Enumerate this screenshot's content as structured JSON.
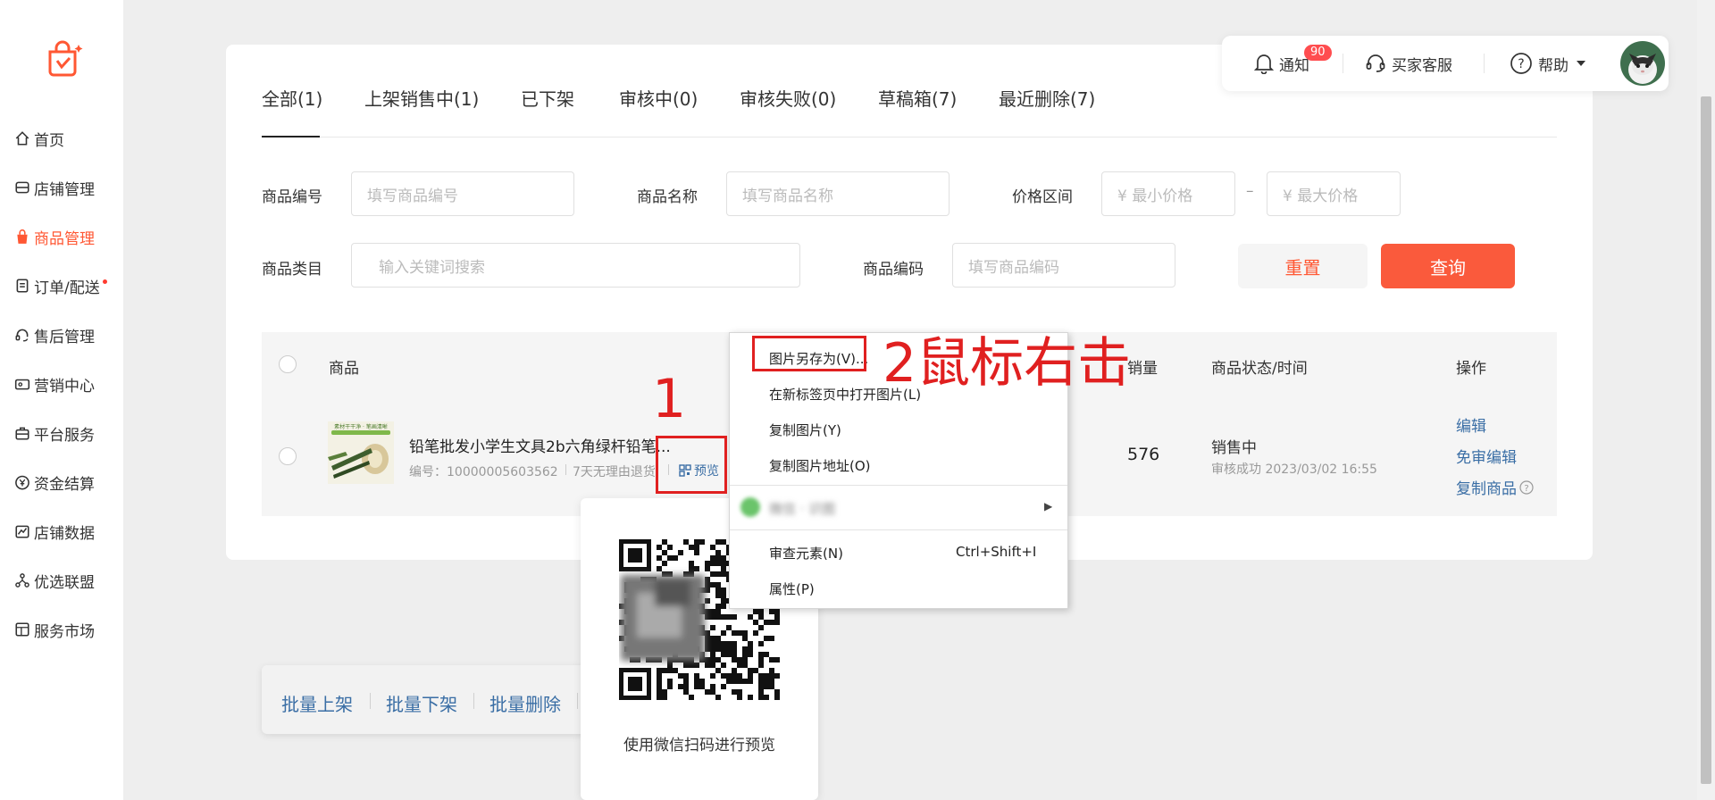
{
  "sidebar": {
    "items": [
      {
        "label": "首页",
        "icon": "home-icon"
      },
      {
        "label": "店铺管理",
        "icon": "store-icon"
      },
      {
        "label": "商品管理",
        "icon": "bag-icon"
      },
      {
        "label": "订单/配送",
        "icon": "order-icon"
      },
      {
        "label": "售后管理",
        "icon": "headset-icon"
      },
      {
        "label": "营销中心",
        "icon": "coupon-icon"
      },
      {
        "label": "平台服务",
        "icon": "briefcase-icon"
      },
      {
        "label": "资金结算",
        "icon": "yen-icon"
      },
      {
        "label": "店铺数据",
        "icon": "chart-icon"
      },
      {
        "label": "优选联盟",
        "icon": "network-icon"
      },
      {
        "label": "服务市场",
        "icon": "market-icon"
      }
    ]
  },
  "topbar": {
    "notify": "通知",
    "notify_count": "90",
    "service": "买家客服",
    "help": "帮助"
  },
  "tabs": [
    "全部(1)",
    "上架销售中(1)",
    "已下架",
    "审核中(0)",
    "审核失败(0)",
    "草稿箱(7)",
    "最近删除(7)"
  ],
  "filters": {
    "product_no_label": "商品编号",
    "product_no_ph": "填写商品编号",
    "product_name_label": "商品名称",
    "product_name_ph": "填写商品名称",
    "price_label": "价格区间",
    "price_min_ph": "¥  最小价格",
    "price_max_ph": "¥  最大价格",
    "price_dash": "–",
    "category_label": "商品类目",
    "category_ph": "输入关键词搜索",
    "code_label": "商品编码",
    "code_ph": "填写商品编码",
    "reset": "重置",
    "query": "查询"
  },
  "table": {
    "headers": {
      "product": "商品",
      "sales": "销量",
      "status": "商品状态/时间",
      "ops": "操作"
    },
    "row": {
      "title": "铅笔批发小学生文具2b六角绿杆铅笔...",
      "meta": "编号：10000005603562",
      "meta2": "7天无理由退货",
      "preview": "预览",
      "thumb_text": "素材干干净 · 笔画清晰",
      "sales": "576",
      "status": "销售中",
      "audit": "审核成功  2023/03/02 16:55",
      "op_edit": "编辑",
      "op_free_edit": "免审编辑",
      "op_copy": "复制商品"
    }
  },
  "bulk": [
    "批量上架",
    "批量下架",
    "批量删除"
  ],
  "qr_caption": "使用微信扫码进行预览",
  "context_menu": {
    "save_image": "图片另存为(V)...",
    "open_new_tab": "在新标签页中打开图片(L)",
    "copy_image": "复制图片(Y)",
    "copy_address": "复制图片地址(O)",
    "blurred_item": "微信 · 识图",
    "inspect": "审查元素(N)",
    "inspect_shortcut": "Ctrl+Shift+I",
    "properties": "属性(P)"
  },
  "annotations": {
    "step1": "1",
    "step2": "2鼠标右击"
  },
  "colors": {
    "accent": "#ff5733",
    "link": "#3a6ea5",
    "annotation": "#e02020"
  }
}
